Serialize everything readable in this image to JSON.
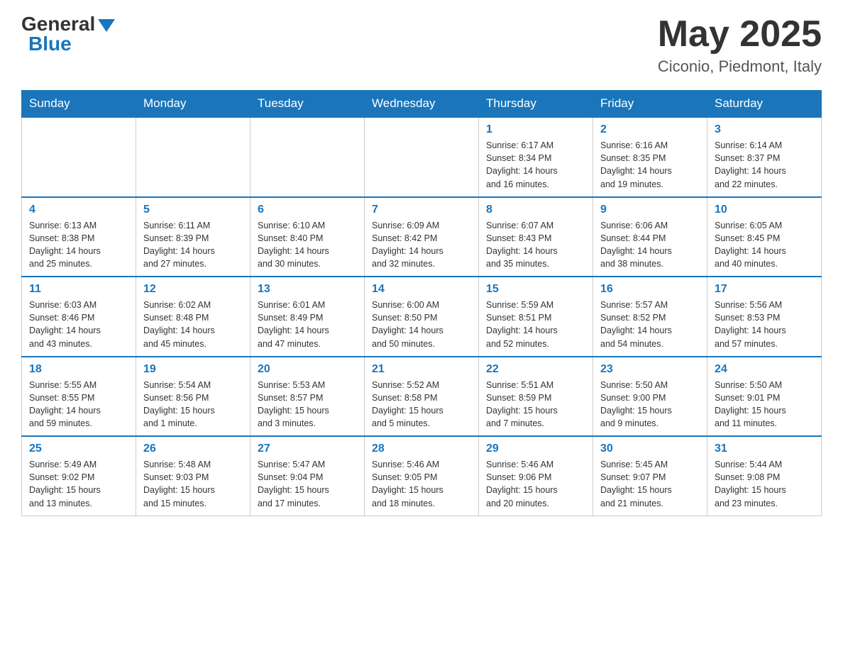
{
  "header": {
    "logo_general": "General",
    "logo_blue": "Blue",
    "month_title": "May 2025",
    "location": "Ciconio, Piedmont, Italy"
  },
  "days_of_week": [
    "Sunday",
    "Monday",
    "Tuesday",
    "Wednesday",
    "Thursday",
    "Friday",
    "Saturday"
  ],
  "weeks": [
    [
      {
        "day": "",
        "info": ""
      },
      {
        "day": "",
        "info": ""
      },
      {
        "day": "",
        "info": ""
      },
      {
        "day": "",
        "info": ""
      },
      {
        "day": "1",
        "info": "Sunrise: 6:17 AM\nSunset: 8:34 PM\nDaylight: 14 hours\nand 16 minutes."
      },
      {
        "day": "2",
        "info": "Sunrise: 6:16 AM\nSunset: 8:35 PM\nDaylight: 14 hours\nand 19 minutes."
      },
      {
        "day": "3",
        "info": "Sunrise: 6:14 AM\nSunset: 8:37 PM\nDaylight: 14 hours\nand 22 minutes."
      }
    ],
    [
      {
        "day": "4",
        "info": "Sunrise: 6:13 AM\nSunset: 8:38 PM\nDaylight: 14 hours\nand 25 minutes."
      },
      {
        "day": "5",
        "info": "Sunrise: 6:11 AM\nSunset: 8:39 PM\nDaylight: 14 hours\nand 27 minutes."
      },
      {
        "day": "6",
        "info": "Sunrise: 6:10 AM\nSunset: 8:40 PM\nDaylight: 14 hours\nand 30 minutes."
      },
      {
        "day": "7",
        "info": "Sunrise: 6:09 AM\nSunset: 8:42 PM\nDaylight: 14 hours\nand 32 minutes."
      },
      {
        "day": "8",
        "info": "Sunrise: 6:07 AM\nSunset: 8:43 PM\nDaylight: 14 hours\nand 35 minutes."
      },
      {
        "day": "9",
        "info": "Sunrise: 6:06 AM\nSunset: 8:44 PM\nDaylight: 14 hours\nand 38 minutes."
      },
      {
        "day": "10",
        "info": "Sunrise: 6:05 AM\nSunset: 8:45 PM\nDaylight: 14 hours\nand 40 minutes."
      }
    ],
    [
      {
        "day": "11",
        "info": "Sunrise: 6:03 AM\nSunset: 8:46 PM\nDaylight: 14 hours\nand 43 minutes."
      },
      {
        "day": "12",
        "info": "Sunrise: 6:02 AM\nSunset: 8:48 PM\nDaylight: 14 hours\nand 45 minutes."
      },
      {
        "day": "13",
        "info": "Sunrise: 6:01 AM\nSunset: 8:49 PM\nDaylight: 14 hours\nand 47 minutes."
      },
      {
        "day": "14",
        "info": "Sunrise: 6:00 AM\nSunset: 8:50 PM\nDaylight: 14 hours\nand 50 minutes."
      },
      {
        "day": "15",
        "info": "Sunrise: 5:59 AM\nSunset: 8:51 PM\nDaylight: 14 hours\nand 52 minutes."
      },
      {
        "day": "16",
        "info": "Sunrise: 5:57 AM\nSunset: 8:52 PM\nDaylight: 14 hours\nand 54 minutes."
      },
      {
        "day": "17",
        "info": "Sunrise: 5:56 AM\nSunset: 8:53 PM\nDaylight: 14 hours\nand 57 minutes."
      }
    ],
    [
      {
        "day": "18",
        "info": "Sunrise: 5:55 AM\nSunset: 8:55 PM\nDaylight: 14 hours\nand 59 minutes."
      },
      {
        "day": "19",
        "info": "Sunrise: 5:54 AM\nSunset: 8:56 PM\nDaylight: 15 hours\nand 1 minute."
      },
      {
        "day": "20",
        "info": "Sunrise: 5:53 AM\nSunset: 8:57 PM\nDaylight: 15 hours\nand 3 minutes."
      },
      {
        "day": "21",
        "info": "Sunrise: 5:52 AM\nSunset: 8:58 PM\nDaylight: 15 hours\nand 5 minutes."
      },
      {
        "day": "22",
        "info": "Sunrise: 5:51 AM\nSunset: 8:59 PM\nDaylight: 15 hours\nand 7 minutes."
      },
      {
        "day": "23",
        "info": "Sunrise: 5:50 AM\nSunset: 9:00 PM\nDaylight: 15 hours\nand 9 minutes."
      },
      {
        "day": "24",
        "info": "Sunrise: 5:50 AM\nSunset: 9:01 PM\nDaylight: 15 hours\nand 11 minutes."
      }
    ],
    [
      {
        "day": "25",
        "info": "Sunrise: 5:49 AM\nSunset: 9:02 PM\nDaylight: 15 hours\nand 13 minutes."
      },
      {
        "day": "26",
        "info": "Sunrise: 5:48 AM\nSunset: 9:03 PM\nDaylight: 15 hours\nand 15 minutes."
      },
      {
        "day": "27",
        "info": "Sunrise: 5:47 AM\nSunset: 9:04 PM\nDaylight: 15 hours\nand 17 minutes."
      },
      {
        "day": "28",
        "info": "Sunrise: 5:46 AM\nSunset: 9:05 PM\nDaylight: 15 hours\nand 18 minutes."
      },
      {
        "day": "29",
        "info": "Sunrise: 5:46 AM\nSunset: 9:06 PM\nDaylight: 15 hours\nand 20 minutes."
      },
      {
        "day": "30",
        "info": "Sunrise: 5:45 AM\nSunset: 9:07 PM\nDaylight: 15 hours\nand 21 minutes."
      },
      {
        "day": "31",
        "info": "Sunrise: 5:44 AM\nSunset: 9:08 PM\nDaylight: 15 hours\nand 23 minutes."
      }
    ]
  ]
}
